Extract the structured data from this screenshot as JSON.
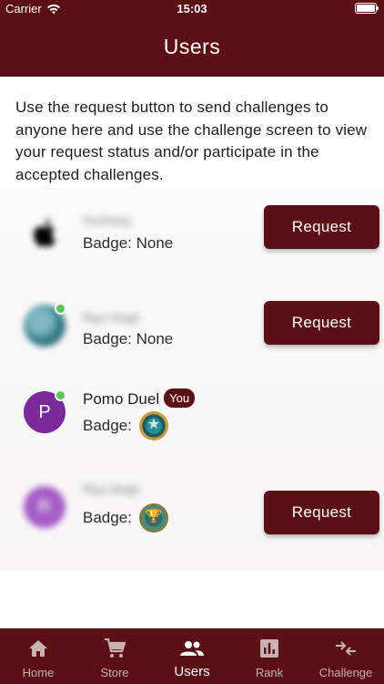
{
  "status_bar": {
    "carrier": "Carrier",
    "time": "15:03"
  },
  "app_bar": {
    "title": "Users"
  },
  "intro_text": "Use the request button to send challenges to anyone here and use the challenge screen to view your request status and/or participate in the accepted challenges.",
  "users": [
    {
      "name": "Hushang",
      "badge_label": "Badge: None",
      "action": "Request"
    },
    {
      "name": "Riya Singh",
      "badge_label": "Badge: None",
      "action": "Request"
    },
    {
      "name": "Pomo Duel",
      "you": "You",
      "initial": "P",
      "badge_label": "Badge:"
    },
    {
      "name": "Riya Singh",
      "initial": "R",
      "badge_label": "Badge:",
      "action": "Request"
    }
  ],
  "tabs": [
    {
      "label": "Home",
      "icon": "home-icon"
    },
    {
      "label": "Store",
      "icon": "cart-icon"
    },
    {
      "label": "Users",
      "icon": "people-icon",
      "active": true
    },
    {
      "label": "Rank",
      "icon": "bar-chart-icon"
    },
    {
      "label": "Challenge",
      "icon": "swap-arrows-icon"
    }
  ],
  "colors": {
    "primary": "#5a1014",
    "online": "#5cc25a",
    "avatar_purple": "#7b2a9c"
  }
}
